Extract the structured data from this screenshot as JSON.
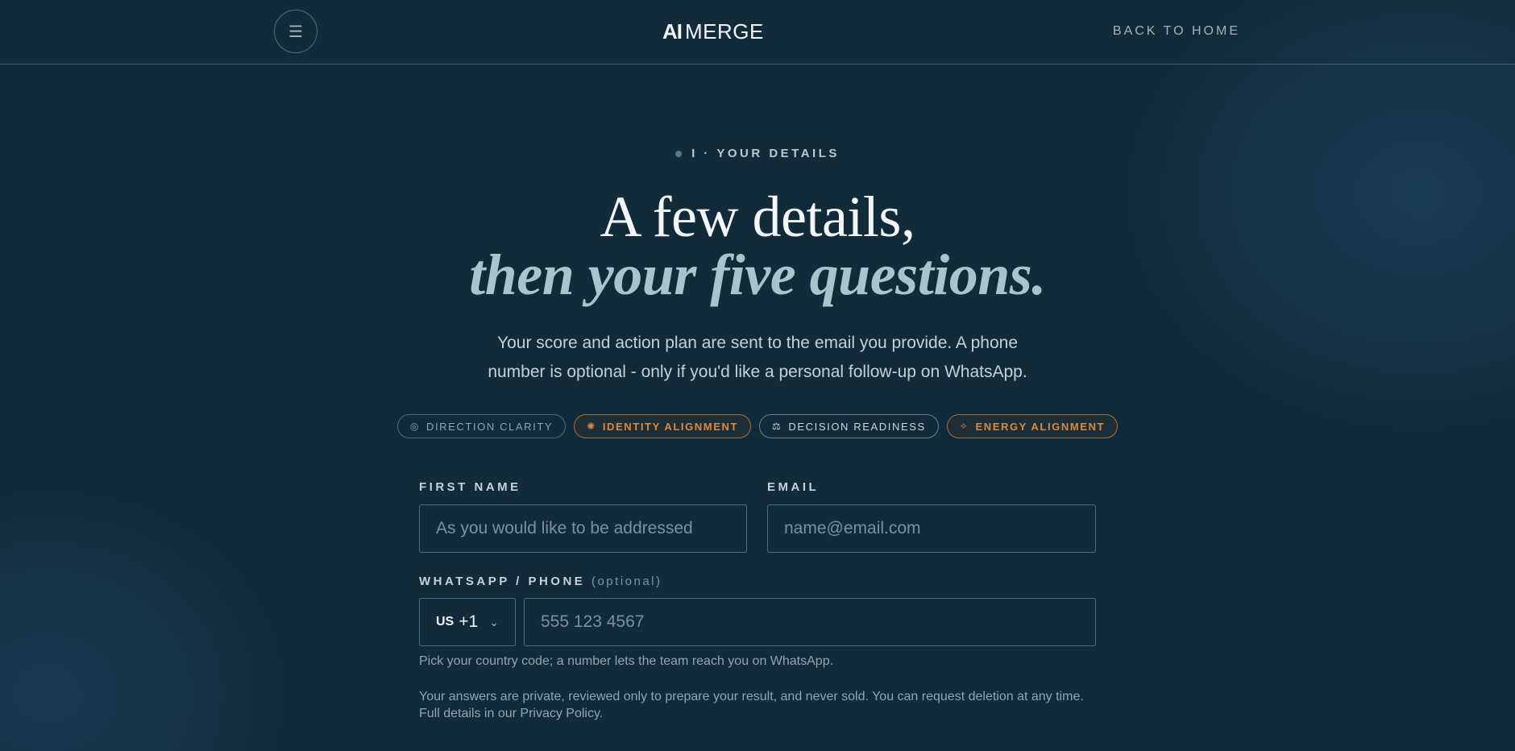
{
  "header": {
    "menu_icon": "hamburger-icon",
    "logo_mark": "AI",
    "logo_word": "MERGE",
    "back_link": "BACK TO HOME"
  },
  "step": {
    "label": "I · YOUR DETAILS"
  },
  "hero": {
    "title_line1": "A few details,",
    "title_line2": "then your five questions.",
    "subtitle": "Your score and action plan are sent to the email you provide. A phone number is optional - only if you'd like a personal follow-up on WhatsApp."
  },
  "tags": [
    {
      "label": "DIRECTION CLARITY",
      "icon": "compass-icon",
      "style": "muted"
    },
    {
      "label": "IDENTITY ALIGNMENT",
      "icon": "fingerprint-icon",
      "style": "orange"
    },
    {
      "label": "DECISION READINESS",
      "icon": "scale-icon",
      "style": "light"
    },
    {
      "label": "ENERGY ALIGNMENT",
      "icon": "spark-icon",
      "style": "orange"
    }
  ],
  "form": {
    "first_name": {
      "label": "FIRST NAME",
      "placeholder": "As you would like to be addressed",
      "value": ""
    },
    "email": {
      "label": "EMAIL",
      "placeholder": "name@email.com",
      "value": ""
    },
    "phone": {
      "label": "WHATSAPP / PHONE",
      "optional_label": "(optional)",
      "country_code": "US",
      "dial_code": "+1",
      "placeholder": "555 123 4567",
      "value": ""
    },
    "phone_hint": "Pick your country code; a number lets the team reach you on WhatsApp.",
    "privacy_line1": "Your answers are private, reviewed only to prepare your result, and never sold. You can request deletion at any time.",
    "privacy_line2": "Full details in our Privacy Policy."
  },
  "colors": {
    "background": "#122b3b",
    "accent_orange": "#d88a46",
    "text_light": "#e6edf1"
  }
}
